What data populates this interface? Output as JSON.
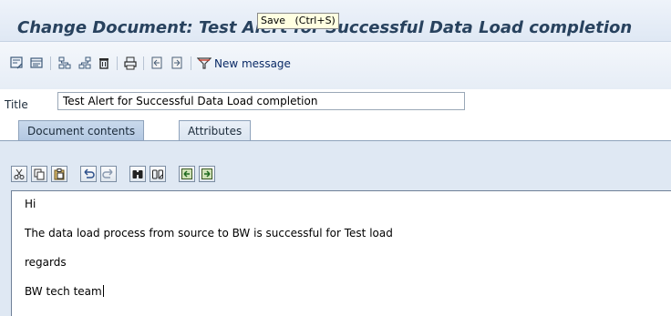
{
  "window": {
    "title": "Change Document: Test Alert for Successful Data Load completion"
  },
  "tooltip": {
    "text": "Save   (Ctrl+S)"
  },
  "toolbar": {
    "new_message_label": "New message",
    "icons": [
      "display-change-icon",
      "document-icon",
      "hierarchy-icon",
      "structure-icon",
      "delete-icon",
      "print-icon",
      "prev-icon",
      "next-icon",
      "new-message-icon"
    ]
  },
  "form": {
    "title_label": "Title",
    "title_value": "Test Alert for Successful Data Load completion"
  },
  "tabs": [
    {
      "label": "Document contents",
      "active": true
    },
    {
      "label": "Attributes",
      "active": false
    }
  ],
  "editor": {
    "toolbar_icons": [
      "cut-icon",
      "copy-icon",
      "paste-icon",
      "undo-icon",
      "redo-icon",
      "find-icon",
      "find-next-icon",
      "import-icon",
      "export-icon"
    ],
    "lines": [
      "Hi",
      "The data load process from source to BW is successful for Test load",
      "regards",
      "BW tech team"
    ]
  },
  "colors": {
    "title_text": "#28425e",
    "panel_bg": "#dfe8f3",
    "tab_active": "#b3c8e2"
  }
}
